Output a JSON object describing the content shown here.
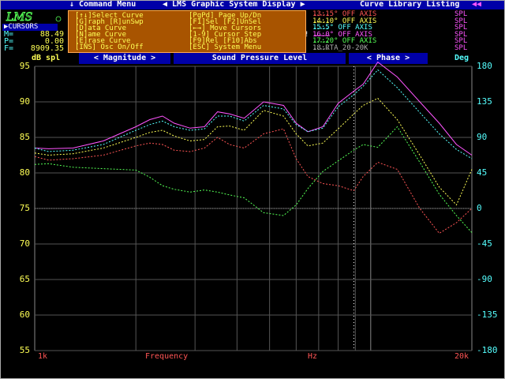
{
  "menubar": {
    "command_menu": "↓ Command Menu",
    "title": "◀ LMS Graphic System Display ▶",
    "library": "Curve Library Listing",
    "scroll_arrow": "◀◀"
  },
  "cursors": {
    "header": "▶CURSORS",
    "rows": [
      {
        "key": "M=",
        "value": "88.49"
      },
      {
        "key": "P=",
        "value": "0.00"
      },
      {
        "key": "F=",
        "value": "8909.35"
      }
    ]
  },
  "commands": [
    "[↑↓]Select Curve",
    "[PgPd] Page Up/Dn",
    "[G]raph [R]unSwp",
    "[F1]Sel [F2]UnSel",
    "[D]ata  Curve",
    "[←→] Move Cursors",
    "[N]ame  Curve",
    "[1-9] Cursor Step",
    "[E]rase Curve",
    "[F9]Rel [F10]Abs",
    "[INS] Osc On/Off",
    "[ESC] System Menu"
  ],
  "library": [
    {
      "name": "13:15° OFF AXIS",
      "type": "SPL",
      "color": "#ff5555",
      "sel": false
    },
    {
      "name": "14:10° OFF AXIS",
      "type": "SPL",
      "color": "#ffff55",
      "sel": false
    },
    {
      "name": "15:5° OFF AXIS",
      "type": "SPL",
      "color": "#55ffff",
      "sel": false
    },
    {
      "name": "16:0° OFF AXIS",
      "type": "SPL",
      "color": "#ff55ff",
      "sel": true
    },
    {
      "name": "17:20° OFF AXIS",
      "type": "SPL",
      "color": "#55ff55",
      "sel": false
    },
    {
      "name": "18:RTA_20-20K",
      "type": "SPL",
      "color": "#aaaaaa",
      "sel": false
    }
  ],
  "bar": {
    "left_unit": "dB spl",
    "magnitude": "< Magnitude >",
    "center": "Sound Pressure Level",
    "phase": "< Phase >",
    "right_unit": "Deg"
  },
  "axes": {
    "left_labels": [
      "95",
      "90",
      "85",
      "80",
      "75",
      "70",
      "65",
      "60",
      "55"
    ],
    "right_labels": [
      "180",
      "135",
      "90",
      "45",
      "0",
      "-45",
      "-90",
      "-135",
      "-180"
    ],
    "x_start": "1k",
    "x_mid": "Frequency",
    "x_unit": "Hz",
    "x_end": "20k"
  },
  "chart_data": {
    "type": "line",
    "title": "Sound Pressure Level",
    "xlabel": "Frequency",
    "ylabel": "dB spl",
    "y2label": "Deg",
    "xscale": "log",
    "xlim": [
      1000,
      20000
    ],
    "ylim": [
      55,
      95
    ],
    "y2lim": [
      -180,
      180
    ],
    "grid": true,
    "cursor_x": 8909.35,
    "series": [
      {
        "name": "16:0° OFF AXIS",
        "color": "#ff55ff",
        "style": "solid",
        "x": [
          1000,
          1100,
          1300,
          1600,
          2000,
          2200,
          2400,
          2600,
          2900,
          3200,
          3500,
          3800,
          4200,
          4800,
          5500,
          6000,
          6500,
          7200,
          8000,
          8900,
          9500,
          10500,
          12000,
          14000,
          16000,
          18000,
          20000
        ],
        "y": [
          83.5,
          83.4,
          83.5,
          84.5,
          86.5,
          87.5,
          88,
          87,
          86.3,
          86.5,
          88.6,
          88.3,
          87.7,
          90,
          89.5,
          87,
          85.8,
          86.5,
          89.8,
          91.5,
          92.5,
          95.6,
          93.5,
          90,
          87,
          84,
          82.5
        ]
      },
      {
        "name": "15:5° OFF AXIS",
        "color": "#55ffff",
        "style": "dashed",
        "x": [
          1000,
          1100,
          1300,
          1600,
          2000,
          2200,
          2400,
          2600,
          2900,
          3200,
          3500,
          3800,
          4200,
          4800,
          5500,
          6000,
          6500,
          7200,
          8000,
          8900,
          9500,
          10500,
          12000,
          14000,
          16000,
          18000,
          20000
        ],
        "y": [
          83.5,
          83,
          83.2,
          84,
          86,
          86.8,
          87.3,
          86.5,
          86,
          86.2,
          88,
          88,
          87.3,
          89.5,
          89,
          86.8,
          85.8,
          86.3,
          89.3,
          91,
          92.2,
          94.5,
          92,
          88.5,
          85.5,
          83.3,
          82
        ]
      },
      {
        "name": "14:10° OFF AXIS",
        "color": "#ffff55",
        "style": "dashed",
        "x": [
          1000,
          1100,
          1300,
          1600,
          2000,
          2200,
          2400,
          2600,
          2900,
          3200,
          3500,
          3800,
          4200,
          4800,
          5500,
          6000,
          6500,
          7200,
          8000,
          8900,
          9500,
          10500,
          12000,
          14000,
          16000,
          18000,
          20000
        ],
        "y": [
          82.8,
          82.5,
          82.7,
          83.5,
          85,
          85.7,
          86,
          85.2,
          84.5,
          84.7,
          86.5,
          86.6,
          86,
          88.8,
          88,
          85.5,
          83.8,
          84.2,
          86.2,
          88.3,
          89.5,
          90.5,
          87.5,
          82.5,
          78,
          75.5,
          80.5
        ]
      },
      {
        "name": "13:15° OFF AXIS",
        "color": "#ff5555",
        "style": "dashed",
        "x": [
          1000,
          1100,
          1300,
          1600,
          2000,
          2200,
          2400,
          2600,
          2900,
          3200,
          3500,
          3800,
          4200,
          4800,
          5500,
          6000,
          6500,
          7200,
          8000,
          8900,
          9500,
          10500,
          12000,
          14000,
          16000,
          18000,
          20000
        ],
        "y": [
          82.3,
          81.8,
          82,
          82.5,
          83.8,
          84.2,
          84,
          83.2,
          83,
          83.5,
          85,
          84,
          83.5,
          85.5,
          86.2,
          82,
          79.5,
          78.5,
          78.2,
          77.5,
          79.5,
          81.5,
          80.5,
          75,
          71.5,
          73,
          75
        ]
      },
      {
        "name": "17:20° OFF AXIS",
        "color": "#55ff55",
        "style": "dashed",
        "x": [
          1000,
          1100,
          1300,
          1600,
          2000,
          2200,
          2400,
          2600,
          2900,
          3200,
          3500,
          3800,
          4200,
          4800,
          5500,
          6000,
          6500,
          7200,
          8000,
          8900,
          9500,
          10500,
          12000,
          14000,
          16000,
          18000,
          20000
        ],
        "y": [
          81.2,
          81.3,
          80.8,
          80.6,
          80.4,
          79.4,
          78.2,
          77.7,
          77.3,
          77.6,
          77.3,
          76.9,
          76.5,
          74.4,
          74,
          75.5,
          77.8,
          80.2,
          81.7,
          83.2,
          84,
          83.6,
          86.5,
          81.5,
          77,
          74,
          71.6
        ]
      }
    ]
  }
}
